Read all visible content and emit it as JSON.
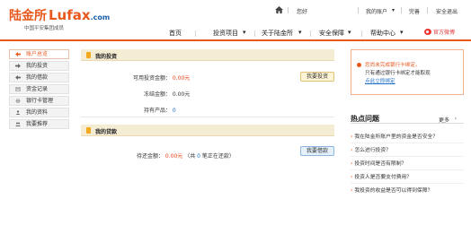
{
  "brand": {
    "name_cn": "陆金所",
    "name_en": "Lufax",
    "domain": ".com",
    "tagline": "中国平安集团成员"
  },
  "utility": {
    "greeting": "您好",
    "my_account": "我的账户",
    "logout": "完善",
    "secure_exit": "安全退出"
  },
  "nav": [
    "首页",
    "投资项目",
    "关于陆金所",
    "安全保障",
    "帮助中心"
  ],
  "weibo": "官方微博",
  "sidebar": {
    "items": [
      {
        "label": "账户总览",
        "icon": "arrow-left-icon"
      },
      {
        "label": "我的投资",
        "icon": "arrow-right-icon"
      },
      {
        "label": "我的借款",
        "icon": "arrow-left-icon"
      },
      {
        "label": "资金记录",
        "icon": "document-icon"
      },
      {
        "label": "银行卡管理",
        "icon": "gear-icon"
      },
      {
        "label": "我的资料",
        "icon": "user-icon"
      },
      {
        "label": "我要推荐",
        "icon": "users-icon"
      }
    ]
  },
  "investment": {
    "title": "我的投资",
    "available_label": "可用投资金额：",
    "available_value": "0.00元",
    "frozen_label": "冻结金额：",
    "frozen_value": "0.00元",
    "products_label": "持有产品：",
    "products_value": "0",
    "button": "我要投资"
  },
  "loan": {
    "title": "我的贷款",
    "repay_label": "待还金额：",
    "repay_value": "0.00元",
    "repay_paren_open": "（共",
    "repay_count": "0",
    "repay_suffix": "笔正在还款）",
    "button": "我要借款"
  },
  "notice": {
    "line1": "您尚未完成银行卡绑定。",
    "line2": "只有通过银行卡绑定才能取现",
    "link": "点此立即绑定"
  },
  "faq": {
    "title": "热点问题",
    "more": "更多",
    "items": [
      "我在陆金所账户里的资金是否安全？",
      "怎么进行投资？",
      "投资时间是否有限制？",
      "投资人是否要支付费用？",
      "我投资的收益是否可以得到保障？"
    ]
  },
  "colors": {
    "brand_orange": "#e8581d",
    "link_blue": "#1b6fc9",
    "panel_head_bg": "#f5ecd4"
  }
}
